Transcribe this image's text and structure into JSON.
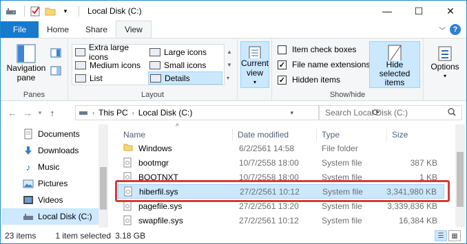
{
  "window": {
    "title": "Local Disk (C:)",
    "minimize": "—",
    "maximize": "☐",
    "close": "✕"
  },
  "tabs": [
    "File",
    "Home",
    "Share",
    "View"
  ],
  "ribbon": {
    "panes": {
      "navigation_pane": "Navigation\npane",
      "label": "Panes"
    },
    "layout": {
      "options": [
        "Extra large icons",
        "Large icons",
        "Medium icons",
        "Small icons",
        "List",
        "Details"
      ],
      "selected": "Details",
      "label": "Layout"
    },
    "current_view": {
      "button": "Current\nview",
      "label": ""
    },
    "show_hide": {
      "item_check_boxes": "Item check boxes",
      "item_check_boxes_checked": false,
      "file_name_extensions": "File name extensions",
      "file_name_extensions_checked": true,
      "hidden_items": "Hidden items",
      "hidden_items_checked": true,
      "hide_selected": "Hide selected\nitems",
      "label": "Show/hide"
    },
    "options": {
      "button": "Options"
    }
  },
  "address": {
    "crumbs": [
      "This PC",
      "Local Disk (C:)"
    ],
    "search_placeholder": "Search Local Disk (C:)"
  },
  "nav": [
    {
      "label": "Documents",
      "icon": "documents-icon"
    },
    {
      "label": "Downloads",
      "icon": "downloads-icon"
    },
    {
      "label": "Music",
      "icon": "music-icon"
    },
    {
      "label": "Pictures",
      "icon": "pictures-icon"
    },
    {
      "label": "Videos",
      "icon": "videos-icon"
    },
    {
      "label": "Local Disk (C:)",
      "icon": "drive-icon",
      "selected": true
    }
  ],
  "columns": [
    "Name",
    "Date modified",
    "Type",
    "Size"
  ],
  "files": [
    {
      "name": "Windows",
      "date": "6/2/2561 14:58",
      "type": "File folder",
      "size": "",
      "icon": "folder-icon"
    },
    {
      "name": "bootmgr",
      "date": "10/7/2558 18:00",
      "type": "System file",
      "size": "387 KB",
      "icon": "system-file-icon"
    },
    {
      "name": "BOOTNXT",
      "date": "10/7/2558 18:00",
      "type": "System file",
      "size": "1 KB",
      "icon": "system-file-icon"
    },
    {
      "name": "hiberfil.sys",
      "date": "27/2/2561 10:12",
      "type": "System file",
      "size": "3,341,980 KB",
      "icon": "system-file-icon",
      "selected": true
    },
    {
      "name": "pagefile.sys",
      "date": "27/2/2561 13:20",
      "type": "System file",
      "size": "3,339,836 KB",
      "icon": "system-file-icon"
    },
    {
      "name": "swapfile.sys",
      "date": "27/2/2561 10:12",
      "type": "System file",
      "size": "16,384 KB",
      "icon": "system-file-icon"
    }
  ],
  "status": {
    "count": "23 items",
    "selected": "1 item selected",
    "size": "3.18 GB"
  },
  "colors": {
    "accent": "#1979ca",
    "selection": "#cce8ff",
    "highlight_box": "#d9393b"
  }
}
